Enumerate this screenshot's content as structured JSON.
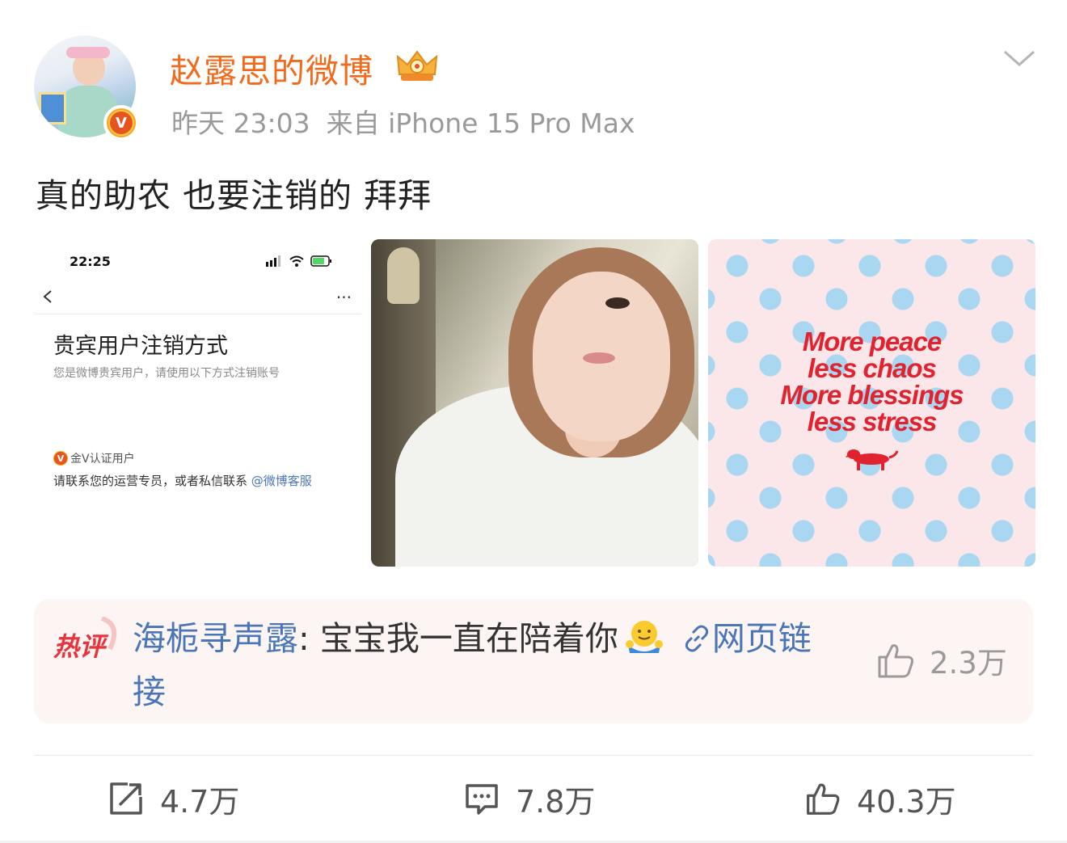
{
  "post": {
    "username": "赵露思的微博",
    "time": "昨天 23:03",
    "source": "来自 iPhone 15 Pro Max",
    "text": "真的助农 也要注销的 拜拜",
    "verified_badge": "V",
    "icons": {
      "crown": "crown-icon",
      "menu": "chevron-down-icon"
    }
  },
  "images": {
    "screenshot": {
      "status_time": "22:25",
      "more": "···",
      "title": "贵宾用户注销方式",
      "subtitle": "您是微博贵宾用户，请使用以下方式注销账号",
      "badge": "V",
      "badge_label": "金V认证用户",
      "contact_text": "请联系您的运营专员，或者私信联系 ",
      "contact_link": "@微博客服"
    },
    "quote": {
      "lines": [
        "More peace",
        "less chaos",
        "More blessings",
        "less stress"
      ],
      "color": "#e0232e"
    }
  },
  "hot_comment": {
    "label": "热评",
    "commenter": "海栀寻声露",
    "text": ": 宝宝我一直在陪着你",
    "link_label": "网页链接",
    "likes": "2.3万"
  },
  "actions": {
    "repost": "4.7万",
    "comment": "7.8万",
    "like": "40.3万"
  },
  "colors": {
    "accent_orange": "#f26a1b",
    "link_blue": "#4a76b8",
    "meta_gray": "#9a9a9a"
  }
}
